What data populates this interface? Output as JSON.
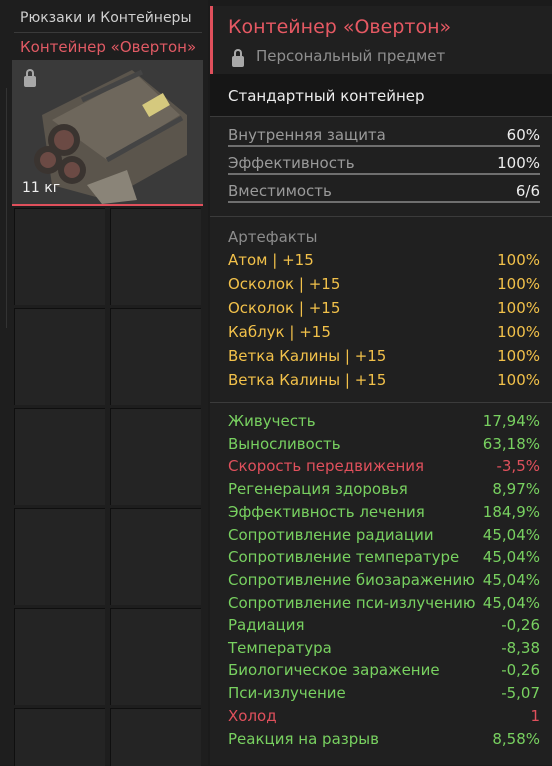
{
  "inventory": {
    "category_title": "Рюкзаки и Контейнеры",
    "item_name": "Контейнер «Овертон»",
    "item_weight": "11 кг"
  },
  "tooltip": {
    "title": "Контейнер «Овертон»",
    "personal_label": "Персональный предмет",
    "type": "Стандартный контейнер",
    "stats": [
      {
        "label": "Внутренняя защита",
        "value": "60%"
      },
      {
        "label": "Эффективность",
        "value": "100%"
      },
      {
        "label": "Вместимость",
        "value": "6/6"
      }
    ],
    "artifacts_header": "Артефакты",
    "artifacts": [
      {
        "label": "Атом | +15",
        "value": "100%"
      },
      {
        "label": "Осколок | +15",
        "value": "100%"
      },
      {
        "label": "Осколок | +15",
        "value": "100%"
      },
      {
        "label": "Каблук | +15",
        "value": "100%"
      },
      {
        "label": "Ветка Калины | +15",
        "value": "100%"
      },
      {
        "label": "Ветка Калины | +15",
        "value": "100%"
      }
    ],
    "effects": [
      {
        "label": "Живучесть",
        "value": "17,94%",
        "tone": "good"
      },
      {
        "label": "Выносливость",
        "value": "63,18%",
        "tone": "good"
      },
      {
        "label": "Скорость передвижения",
        "value": "-3,5%",
        "tone": "bad"
      },
      {
        "label": "Регенерация здоровья",
        "value": "8,97%",
        "tone": "good"
      },
      {
        "label": "Эффективность лечения",
        "value": "184,9%",
        "tone": "good"
      },
      {
        "label": "Сопротивление радиации",
        "value": "45,04%",
        "tone": "good"
      },
      {
        "label": "Сопротивление температуре",
        "value": "45,04%",
        "tone": "good"
      },
      {
        "label": "Сопротивление биозаражению",
        "value": "45,04%",
        "tone": "good"
      },
      {
        "label": "Сопротивление пси-излучению",
        "value": "45,04%",
        "tone": "good"
      },
      {
        "label": "Радиация",
        "value": "-0,26",
        "tone": "good"
      },
      {
        "label": "Температура",
        "value": "-8,38",
        "tone": "good"
      },
      {
        "label": "Биологическое заражение",
        "value": "-0,26",
        "tone": "good"
      },
      {
        "label": "Пси-излучение",
        "value": "-5,07",
        "tone": "good"
      },
      {
        "label": "Холод",
        "value": "1",
        "tone": "bad"
      },
      {
        "label": "Реакция на разрыв",
        "value": "8,58%",
        "tone": "good"
      }
    ]
  },
  "colors": {
    "accent": "#e0505c",
    "artifact": "#f2c14a",
    "positive": "#78d160",
    "negative": "#e0505c"
  }
}
